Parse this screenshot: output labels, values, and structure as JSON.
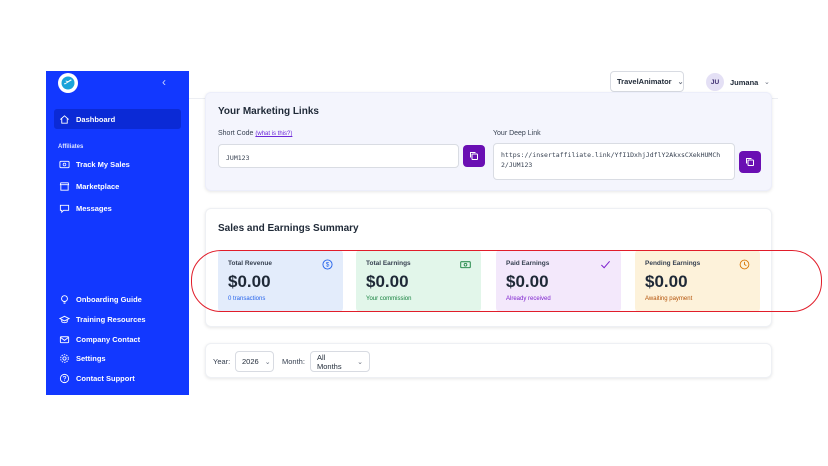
{
  "sidebar": {
    "collapse_icon": "chevron-left-icon",
    "dashboard_label": "Dashboard",
    "section_affiliates": "Affiliates",
    "items": [
      {
        "label": "Track My Sales",
        "icon": "dollar-card-icon"
      },
      {
        "label": "Marketplace",
        "icon": "store-icon"
      },
      {
        "label": "Messages",
        "icon": "chat-icon"
      }
    ],
    "bottom_items": [
      {
        "label": "Onboarding Guide",
        "icon": "lightbulb-icon"
      },
      {
        "label": "Training Resources",
        "icon": "graduation-cap-icon"
      },
      {
        "label": "Company Contact",
        "icon": "mail-icon"
      },
      {
        "label": "Settings",
        "icon": "gear-icon"
      },
      {
        "label": "Contact Support",
        "icon": "help-circle-icon"
      }
    ],
    "accent": "#1238ff"
  },
  "topbar": {
    "project": "TravelAnimator",
    "avatar_initials": "JU",
    "user_name": "Jumana"
  },
  "links": {
    "title": "Your Marketing Links",
    "short_code_label": "Short Code",
    "what_is_this": "(what is this?)",
    "short_code_value": "JUM123",
    "deep_link_label": "Your Deep Link",
    "deep_link_value": "https://insertaffiliate.link/YfI1DxhjJdflY2AkxsCXekHUMCh2/JUM123"
  },
  "summary": {
    "title": "Sales and Earnings Summary",
    "revenue": {
      "label": "Total Revenue",
      "value": "$0.00",
      "sub": "0 transactions"
    },
    "earnings": {
      "label": "Total Earnings",
      "value": "$0.00",
      "sub": "Your commission"
    },
    "paid": {
      "label": "Paid Earnings",
      "value": "$0.00",
      "sub": "Already received"
    },
    "pending": {
      "label": "Pending Earnings",
      "value": "$0.00",
      "sub": "Awaiting payment"
    }
  },
  "filters": {
    "year_label": "Year:",
    "year_value": "2026",
    "month_label": "Month:",
    "month_value": "All Months"
  },
  "colors": {
    "copy_button": "#6a0fb3",
    "highlight": "#e11d2a"
  }
}
